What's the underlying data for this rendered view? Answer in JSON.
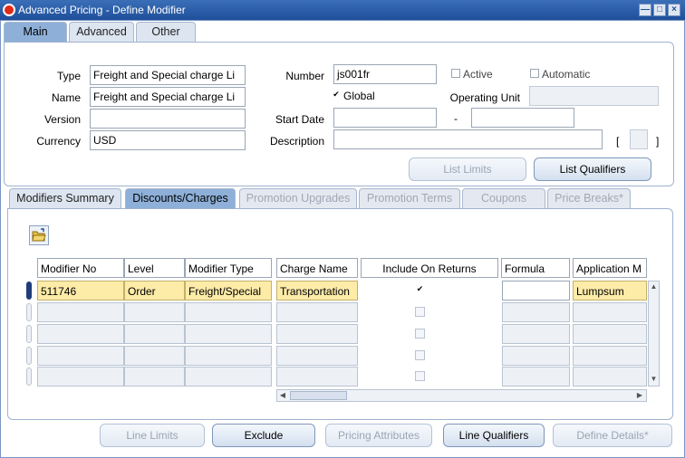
{
  "window": {
    "title": "Advanced Pricing - Define Modifier"
  },
  "main_tabs": [
    {
      "label": "Main"
    },
    {
      "label": "Advanced"
    },
    {
      "label": "Other"
    }
  ],
  "header": {
    "type_label": "Type",
    "type_value": "Freight and Special charge Li",
    "name_label": "Name",
    "name_value": "Freight and Special charge Li",
    "version_label": "Version",
    "version_value": "",
    "currency_label": "Currency",
    "currency_value": "USD",
    "number_label": "Number",
    "number_value": "js001fr",
    "active_label": "Active",
    "active_checked": false,
    "automatic_label": "Automatic",
    "automatic_checked": false,
    "global_label": "Global",
    "global_checked": true,
    "operating_unit_label": "Operating Unit",
    "operating_unit_value": "",
    "start_date_label": "Start Date",
    "start_date_value": "",
    "end_date_value": "",
    "date_separator": "-",
    "description_label": "Description",
    "description_value": "",
    "dff_open": "[",
    "dff_close": "]",
    "list_limits_button": "List Limits",
    "list_qualifiers_button": "List Qualifiers"
  },
  "line_tabs": [
    {
      "label": "Modifiers Summary"
    },
    {
      "label": "Discounts/Charges"
    },
    {
      "label": "Promotion Upgrades"
    },
    {
      "label": "Promotion Terms"
    },
    {
      "label": "Coupons"
    },
    {
      "label": "Price Breaks*"
    }
  ],
  "grid": {
    "columns": [
      "Modifier No",
      "Level",
      "Modifier Type",
      "Charge Name",
      "Include On Returns",
      "Formula",
      "Application M"
    ],
    "rows": [
      {
        "modifier_no": "511746",
        "level": "Order",
        "modifier_type": "Freight/Special",
        "charge_name": "Transportation",
        "include_on_returns": true,
        "formula": "",
        "application_method": "Lumpsum"
      },
      {
        "modifier_no": "",
        "level": "",
        "modifier_type": "",
        "charge_name": "",
        "include_on_returns": false,
        "formula": "",
        "application_method": ""
      },
      {
        "modifier_no": "",
        "level": "",
        "modifier_type": "",
        "charge_name": "",
        "include_on_returns": false,
        "formula": "",
        "application_method": ""
      },
      {
        "modifier_no": "",
        "level": "",
        "modifier_type": "",
        "charge_name": "",
        "include_on_returns": false,
        "formula": "",
        "application_method": ""
      },
      {
        "modifier_no": "",
        "level": "",
        "modifier_type": "",
        "charge_name": "",
        "include_on_returns": false,
        "formula": "",
        "application_method": ""
      }
    ]
  },
  "footer_buttons": {
    "line_limits": "Line Limits",
    "exclude": "Exclude",
    "pricing_attributes": "Pricing Attributes",
    "line_qualifiers": "Line Qualifiers",
    "define_details": "Define Details*"
  },
  "icons": {
    "app": "oracle-icon",
    "minimize": "minimize-icon",
    "maximize": "maximize-icon",
    "close": "close-icon",
    "folder": "open-folder-icon",
    "scroll_left": "arrow-left-icon",
    "scroll_right": "arrow-right-icon",
    "scroll_up": "arrow-up-icon",
    "scroll_down": "arrow-down-icon"
  },
  "colors": {
    "titlebar": "#2a5fa8",
    "active_tab": "#8eb0d8",
    "selected_row": "#fdeba8",
    "disabled_field": "#edf1f6"
  }
}
